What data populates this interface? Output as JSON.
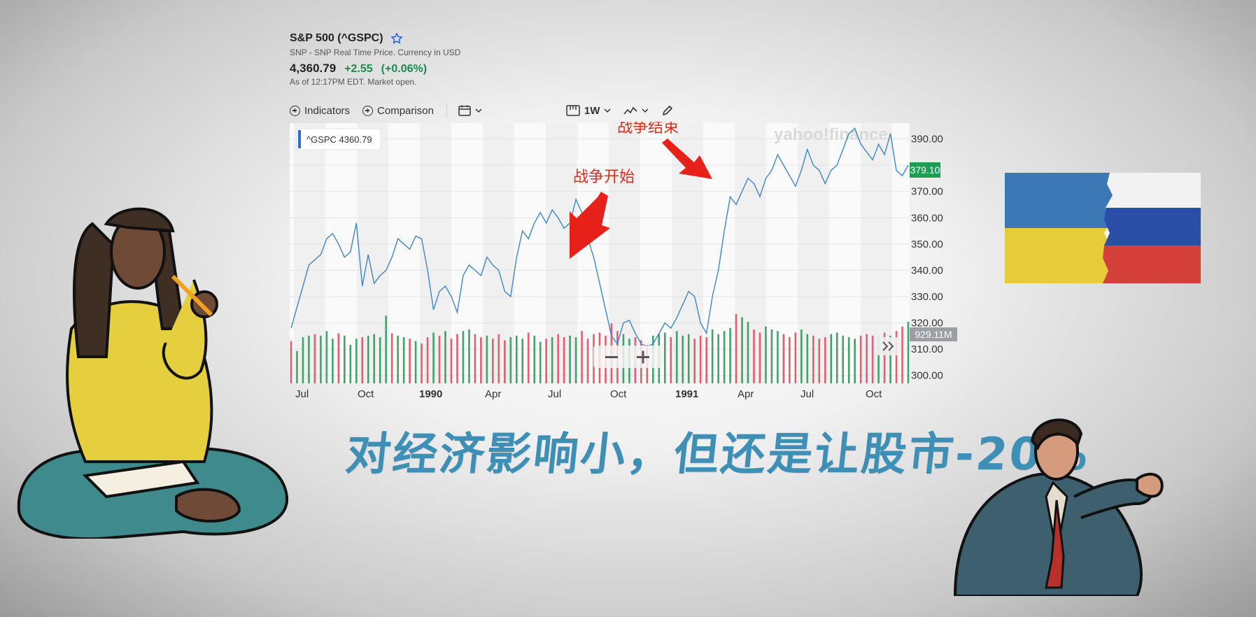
{
  "header": {
    "title": "S&P 500 (^GSPC)",
    "subtitle": "SNP - SNP Real Time Price. Currency in USD",
    "price": "4,360.79",
    "change": "+2.55",
    "change_pct": "(+0.06%)",
    "as_of": "As of 12:17PM EDT. Market open."
  },
  "toolbar": {
    "indicators": "Indicators",
    "comparison": "Comparison",
    "range": "1W"
  },
  "chart_data": {
    "type": "line",
    "watermark": "yahoo!finance",
    "legend_tag": "^GSPC 4360.79",
    "last_price_tag": "379.10",
    "volume_tag": "929.11M",
    "x_tick_labels": [
      "Jul",
      "Oct",
      "1990",
      "Apr",
      "Jul",
      "Oct",
      "1991",
      "Apr",
      "Jul",
      "Oct"
    ],
    "y_ticks": [
      300,
      310,
      320,
      330,
      340,
      350,
      360,
      370,
      380,
      390
    ],
    "y_tick_labels": [
      "300.00",
      "310.00",
      "320.00",
      "330.00",
      "340.00",
      "350.00",
      "360.00",
      "370.00",
      "",
      "390.00"
    ],
    "ylim": [
      297,
      396
    ],
    "series": [
      {
        "values": [
          318,
          326,
          334,
          342,
          344,
          346,
          352,
          354,
          350,
          345,
          347,
          358,
          334,
          346,
          335,
          338,
          340,
          345,
          352,
          350,
          348,
          353,
          352,
          340,
          325,
          332,
          334,
          330,
          324,
          338,
          342,
          340,
          338,
          345,
          342,
          340,
          332,
          330,
          345,
          355,
          352,
          358,
          362,
          358,
          363,
          360,
          356,
          358,
          367,
          362,
          352,
          345,
          335,
          325,
          315,
          312,
          320,
          321,
          316,
          312,
          311,
          312,
          316,
          320,
          318,
          322,
          327,
          332,
          330,
          320,
          316,
          330,
          340,
          355,
          368,
          365,
          370,
          375,
          373,
          368,
          375,
          378,
          384,
          380,
          376,
          372,
          378,
          386,
          380,
          378,
          373,
          378,
          380,
          386,
          392,
          394,
          388,
          385,
          382,
          388,
          384,
          392,
          378,
          376,
          380
        ]
      }
    ],
    "volume": {
      "heights": [
        0.55,
        0.42,
        0.6,
        0.62,
        0.64,
        0.62,
        0.68,
        0.58,
        0.65,
        0.62,
        0.5,
        0.58,
        0.6,
        0.62,
        0.64,
        0.6,
        0.88,
        0.65,
        0.62,
        0.6,
        0.58,
        0.55,
        0.52,
        0.6,
        0.66,
        0.62,
        0.68,
        0.58,
        0.64,
        0.68,
        0.7,
        0.64,
        0.6,
        0.62,
        0.58,
        0.64,
        0.56,
        0.6,
        0.62,
        0.58,
        0.66,
        0.62,
        0.54,
        0.58,
        0.6,
        0.64,
        0.6,
        0.62,
        0.6,
        0.68,
        0.58,
        0.64,
        0.66,
        0.62,
        0.78,
        0.68,
        0.64,
        0.58,
        0.6,
        0.56,
        0.5,
        0.62,
        0.64,
        0.66,
        0.6,
        0.68,
        0.62,
        0.64,
        0.58,
        0.62,
        0.6,
        0.7,
        0.64,
        0.68,
        0.72,
        0.9,
        0.86,
        0.8,
        0.7,
        0.66,
        0.74,
        0.7,
        0.68,
        0.64,
        0.6,
        0.66,
        0.7,
        0.64,
        0.62,
        0.58,
        0.6,
        0.64,
        0.66,
        0.62,
        0.6,
        0.58,
        0.62,
        0.64,
        0.62,
        0.6,
        0.66,
        0.62,
        0.68,
        0.74,
        0.8
      ],
      "up": [
        0,
        1,
        1,
        1,
        0,
        1,
        1,
        1,
        0,
        1,
        1,
        1,
        0,
        1,
        1,
        1,
        1,
        0,
        1,
        1,
        0,
        1,
        0,
        0,
        1,
        0,
        1,
        0,
        0,
        1,
        1,
        0,
        0,
        1,
        0,
        0,
        0,
        1,
        1,
        1,
        0,
        1,
        1,
        0,
        1,
        0,
        0,
        1,
        1,
        0,
        0,
        0,
        0,
        0,
        0,
        0,
        1,
        1,
        0,
        0,
        0,
        1,
        1,
        1,
        0,
        1,
        1,
        1,
        0,
        0,
        0,
        1,
        1,
        1,
        1,
        0,
        1,
        1,
        0,
        0,
        1,
        1,
        1,
        0,
        0,
        0,
        1,
        1,
        0,
        0,
        0,
        1,
        1,
        1,
        1,
        1,
        0,
        0,
        0,
        1,
        0,
        1,
        0,
        0,
        1
      ]
    },
    "annotations": [
      {
        "text": "战争开始"
      },
      {
        "text": "战争结束"
      }
    ],
    "grid": true
  },
  "headline": "对经济影响小，但还是让股市-20%",
  "colors": {
    "line": "#3d86c6",
    "volume_up": "#43a26a",
    "volume_down": "#e0606f",
    "annotation": "#e02c1c",
    "headline": "#3e8fb5",
    "price_tag": "#1e9e55"
  }
}
